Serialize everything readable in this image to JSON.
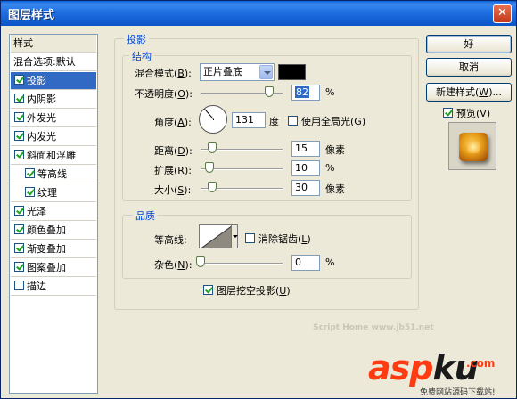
{
  "window": {
    "title": "图层样式",
    "close_glyph": "✕"
  },
  "styles_panel": {
    "header": "样式",
    "blend_options": "混合选项:默认",
    "items": [
      {
        "label": "投影",
        "checked": true,
        "selected": true
      },
      {
        "label": "内阴影",
        "checked": true
      },
      {
        "label": "外发光",
        "checked": true
      },
      {
        "label": "内发光",
        "checked": true
      },
      {
        "label": "斜面和浮雕",
        "checked": true
      },
      {
        "label": "等高线",
        "checked": true
      },
      {
        "label": "纹理",
        "checked": true
      },
      {
        "label": "光泽",
        "checked": true
      },
      {
        "label": "颜色叠加",
        "checked": true
      },
      {
        "label": "渐变叠加",
        "checked": true
      },
      {
        "label": "图案叠加",
        "checked": true
      },
      {
        "label": "描边",
        "checked": false
      }
    ]
  },
  "drop_shadow": {
    "title": "投影",
    "structure": {
      "title": "结构",
      "blend_mode_label": "混合模式",
      "blend_mode_key": "B",
      "blend_mode_value": "正片叠底",
      "shadow_color": "#000000",
      "opacity_label": "不透明度",
      "opacity_key": "O",
      "opacity_value": "82",
      "opacity_unit": "%",
      "angle_label": "角度",
      "angle_key": "A",
      "angle_value": "131",
      "angle_unit": "度",
      "global_light_label": "使用全局光",
      "global_light_key": "G",
      "global_light_checked": false,
      "distance_label": "距离",
      "distance_key": "D",
      "distance_value": "15",
      "distance_unit": "像素",
      "spread_label": "扩展",
      "spread_key": "R",
      "spread_value": "10",
      "spread_unit": "%",
      "size_label": "大小",
      "size_key": "S",
      "size_value": "30",
      "size_unit": "像素"
    },
    "quality": {
      "title": "品质",
      "contour_label": "等高线:",
      "antialias_label": "消除锯齿",
      "antialias_key": "L",
      "antialias_checked": false,
      "noise_label": "杂色",
      "noise_key": "N",
      "noise_value": "0",
      "noise_unit": "%"
    },
    "knockout_label": "图层挖空投影",
    "knockout_key": "U",
    "knockout_checked": true
  },
  "buttons": {
    "ok": "好",
    "cancel": "取消",
    "new_style": "新建样式",
    "new_style_key": "W",
    "new_style_suffix": "...",
    "preview_label": "预览",
    "preview_key": "V",
    "preview_checked": true
  },
  "watermark": {
    "text": "asp",
    "text2": "ku",
    "ext": ".com",
    "faint": "Script Home www.jb51.net",
    "sub": "免费网站源码下载站!"
  }
}
